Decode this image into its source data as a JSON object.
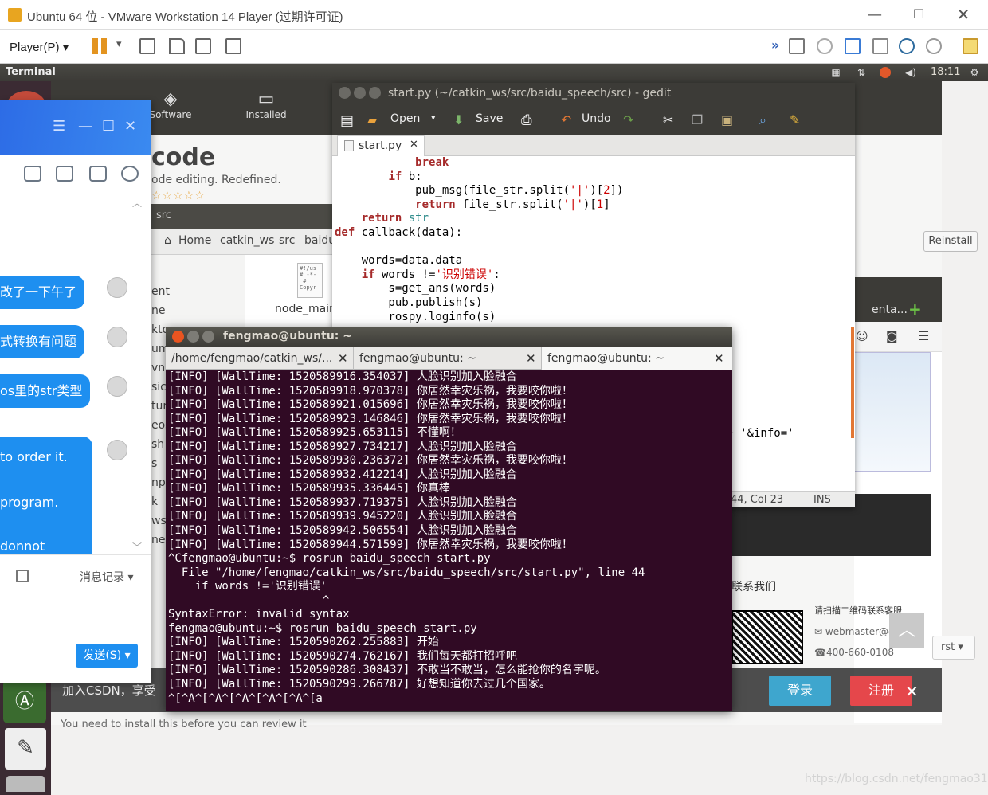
{
  "vmware": {
    "title": "Ubuntu 64 位 - VMware Workstation 14 Player (过期许可证)",
    "player_menu": "Player(P)",
    "win_min": "—",
    "win_max": "☐",
    "win_close": "✕"
  },
  "ubuntu_panel": {
    "app_name": "Terminal",
    "clock": "18:11"
  },
  "software_center": {
    "software_label": "Software",
    "installed_label": "Installed",
    "app_name": "code",
    "tagline": "ode editing. Redefined.",
    "stars": "☆☆☆☆☆",
    "reinstall": "Reinstall",
    "footer_note": "You need to install this before you can review it"
  },
  "file_manager": {
    "header_folder": "src",
    "crumbs": [
      "Home",
      "catkin_ws",
      "src",
      "baidu"
    ],
    "side_items": [
      "ent",
      "ne",
      "kto",
      "um",
      "vnl",
      "sic",
      "ture",
      "eos",
      "sh",
      "s",
      "np",
      "k",
      "ws",
      "ne"
    ],
    "file_name": "node_main",
    "file_icon_text": "#!/us\n# -*-\n #\nCopyr"
  },
  "gedit": {
    "title": "start.py (~/catkin_ws/src/baidu_speech/src) - gedit",
    "toolbar": {
      "open": "Open",
      "save": "Save",
      "undo": "Undo"
    },
    "tab": "start.py",
    "code_lines": [
      [
        "",
        [
          [
            "            ",
            ""
          ],
          [
            "break",
            "kw"
          ]
        ]
      ],
      [
        "",
        [
          [
            "        ",
            ""
          ],
          [
            "if",
            "kw"
          ],
          [
            " b:",
            ""
          ]
        ]
      ],
      [
        "",
        [
          [
            "            pub_msg(file_str.split(",
            ""
          ],
          [
            "'|'",
            "st"
          ],
          [
            ")[",
            ""
          ],
          [
            "2",
            "st"
          ],
          [
            "])",
            ""
          ]
        ]
      ],
      [
        "",
        [
          [
            "            ",
            ""
          ],
          [
            "return",
            "kw"
          ],
          [
            " file_str.split(",
            ""
          ],
          [
            "'|'",
            "st"
          ],
          [
            ")[",
            ""
          ],
          [
            "1",
            "st"
          ],
          [
            "]",
            ""
          ]
        ]
      ],
      [
        "",
        [
          [
            "    ",
            ""
          ],
          [
            "return",
            "kw"
          ],
          [
            " ",
            ""
          ],
          [
            "str",
            "bi"
          ]
        ]
      ],
      [
        "",
        [
          [
            "def",
            "kw"
          ],
          [
            " callback(data):",
            ""
          ]
        ]
      ],
      [
        "",
        [
          [
            "",
            ""
          ]
        ]
      ],
      [
        "",
        [
          [
            "    words=data.data",
            ""
          ]
        ]
      ],
      [
        "",
        [
          [
            "    ",
            ""
          ],
          [
            "if",
            "kw"
          ],
          [
            " words !=",
            ""
          ],
          [
            "'识别错误'",
            "st"
          ],
          [
            ":",
            ""
          ]
        ]
      ],
      [
        "",
        [
          [
            "        s=get_ans(words)",
            ""
          ]
        ]
      ],
      [
        "",
        [
          [
            "        pub.publish(s)",
            ""
          ]
        ]
      ],
      [
        "",
        [
          [
            "        rospy.loginfo(s)",
            ""
          ]
        ]
      ]
    ],
    "code_fragment": "ey + '&info='",
    "status_pos": "44, Col 23",
    "status_mode": "INS"
  },
  "browser": {
    "tab_label": "enta...",
    "contact": "联系我们",
    "qr_text": "请扫描二维码联系客服",
    "mail": "webmaster@c",
    "tel": "400-660-0108",
    "sort_label": "rst",
    "join": "加入CSDN，享受",
    "login": "登录",
    "register": "注册",
    "watermark": "https://blog.csdn.net/fengmao31"
  },
  "qq": {
    "messages": [
      "改了一下午了",
      "式转换有问题",
      "os里的str类型"
    ],
    "long_message": [
      "to order it.",
      "program.",
      "donnot"
    ],
    "history": "消息记录",
    "send": "发送(S)"
  },
  "terminal": {
    "title": "fengmao@ubuntu: ~",
    "tabs": [
      "/home/fengmao/catkin_ws/...",
      "fengmao@ubuntu: ~",
      "fengmao@ubuntu: ~"
    ],
    "lines": [
      "[INFO] [WallTime: 1520589916.354037] 人脸识别加入脸融合",
      "[INFO] [WallTime: 1520589918.970378] 你居然幸灾乐祸，我要咬你啦！",
      "[INFO] [WallTime: 1520589921.015696] 你居然幸灾乐祸，我要咬你啦！",
      "[INFO] [WallTime: 1520589923.146846] 你居然幸灾乐祸，我要咬你啦！",
      "[INFO] [WallTime: 1520589925.653115] 不懂啊！",
      "[INFO] [WallTime: 1520589927.734217] 人脸识别加入脸融合",
      "[INFO] [WallTime: 1520589930.236372] 你居然幸灾乐祸，我要咬你啦！",
      "[INFO] [WallTime: 1520589932.412214] 人脸识别加入脸融合",
      "[INFO] [WallTime: 1520589935.336445] 你真棒",
      "[INFO] [WallTime: 1520589937.719375] 人脸识别加入脸融合",
      "[INFO] [WallTime: 1520589939.945220] 人脸识别加入脸融合",
      "[INFO] [WallTime: 1520589942.506554] 人脸识别加入脸融合",
      "[INFO] [WallTime: 1520589944.571599] 你居然幸灾乐祸，我要咬你啦！",
      "^Cfengmao@ubuntu:~$ rosrun baidu_speech start.py",
      "  File \"/home/fengmao/catkin_ws/src/baidu_speech/src/start.py\", line 44",
      "    if words !='识别错误'",
      "                       ^",
      "SyntaxError: invalid syntax",
      "fengmao@ubuntu:~$ rosrun baidu_speech start.py",
      "[INFO] [WallTime: 1520590262.255883] 开始",
      "[INFO] [WallTime: 1520590274.762167] 我们每天都打招呼吧",
      "[INFO] [WallTime: 1520590286.308437] 不敢当不敢当，怎么能抢你的名字呢。",
      "[INFO] [WallTime: 1520590299.266787] 好想知道你去过几个国家。",
      "^[^A^[^A^[^A^[^A^[^A^[a"
    ]
  }
}
